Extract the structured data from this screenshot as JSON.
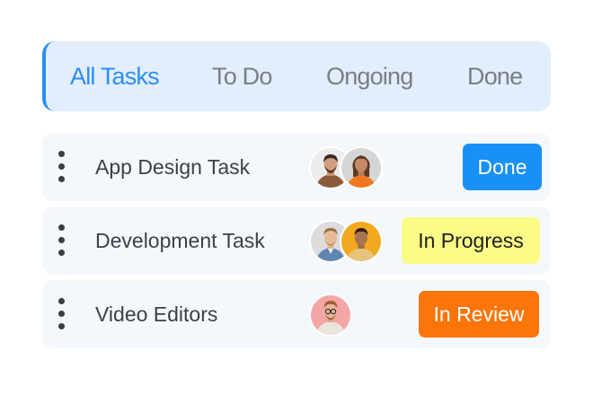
{
  "tabs": [
    {
      "label": "All Tasks",
      "active": true
    },
    {
      "label": "To Do",
      "active": false
    },
    {
      "label": "Ongoing",
      "active": false
    },
    {
      "label": "Done",
      "active": false
    }
  ],
  "tasks": [
    {
      "name": "App Design Task",
      "status": "Done",
      "status_color": "#1990f7",
      "assignees": [
        "man-brown-shirt-avatar",
        "woman-orange-top-avatar"
      ]
    },
    {
      "name": "Development Task",
      "status": "In Progress",
      "status_color": "#fbfb86",
      "assignees": [
        "man-denim-shirt-avatar",
        "man-yellow-background-avatar"
      ]
    },
    {
      "name": "Video Editors",
      "status": "In Review",
      "status_color": "#fb7508",
      "assignees": [
        "man-glasses-pink-background-avatar"
      ]
    }
  ],
  "colors": {
    "accent": "#2c8df5",
    "tab_bar_bg": "#e2eefc",
    "row_bg": "#f4f8fd"
  }
}
